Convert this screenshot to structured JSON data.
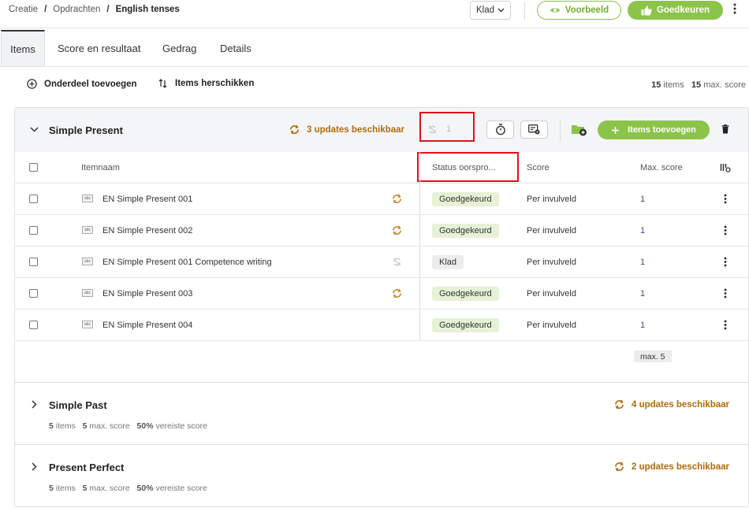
{
  "breadcrumb": {
    "items": [
      "Creatie",
      "Opdrachten",
      "English tenses"
    ],
    "separator": "/"
  },
  "header": {
    "status_select": "Klad",
    "preview_label": "Voorbeeld",
    "approve_label": "Goedkeuren"
  },
  "tabs": [
    {
      "label": "Items",
      "active": true
    },
    {
      "label": "Score en resultaat"
    },
    {
      "label": "Gedrag"
    },
    {
      "label": "Details"
    }
  ],
  "toolbar": {
    "add_part": "Onderdeel toevoegen",
    "reorder": "Items herschikken"
  },
  "summary": {
    "items_count": "15",
    "items_label": "items",
    "max_score": "15",
    "max_score_label": "max. score"
  },
  "section": {
    "title": "Simple Present",
    "updates": "3 updates beschikbaar",
    "count_field": "1",
    "add_items_label": "Items toevoegen",
    "columns": {
      "name": "Itemnaam",
      "status": "Status oorspro...",
      "score": "Score",
      "max": "Max. score"
    },
    "rows": [
      {
        "name": "EN Simple Present 001",
        "status": "Goedgekeurd",
        "score": "Per invulveld",
        "max": "1",
        "update": "available"
      },
      {
        "name": "EN Simple Present 002",
        "status": "Goedgekeurd",
        "score": "Per invulveld",
        "max": "1",
        "update": "available"
      },
      {
        "name": "EN Simple Present 001 Competence writing",
        "status": "Klad",
        "score": "Per invulveld",
        "max": "1",
        "update": "none"
      },
      {
        "name": "EN Simple Present 003",
        "status": "Goedgekeurd",
        "score": "Per invulveld",
        "max": "1",
        "update": "available"
      },
      {
        "name": "EN Simple Present 004",
        "status": "Goedgekeurd",
        "score": "Per invulveld",
        "max": "1",
        "update": ""
      }
    ],
    "total_label": "max. 5"
  },
  "collapsed_sections": [
    {
      "title": "Simple Past",
      "updates": "4 updates beschikbaar",
      "items": "5",
      "items_label": "items",
      "max": "5",
      "max_label": "max. score",
      "required": "50%",
      "required_label": "vereiste score"
    },
    {
      "title": "Present Perfect",
      "updates": "2 updates beschikbaar",
      "items": "5",
      "items_label": "items",
      "max": "5",
      "max_label": "max. score",
      "required": "50%",
      "required_label": "vereiste score"
    }
  ],
  "icon_names": [
    "chevron-down-icon",
    "eye-icon",
    "thumbs-up-icon",
    "kebab-icon",
    "plus-circle-icon",
    "reorder-icon",
    "sync-icon",
    "unlink-icon",
    "stopwatch-icon",
    "settings-card-icon",
    "folder-add-icon",
    "trash-icon",
    "columns-settings-icon",
    "chevron-right-icon",
    "document-icon"
  ],
  "colors": {
    "accent_green": "#8cc34b",
    "update_orange": "#b26b0a",
    "highlight_red": "#e0101a",
    "approved_badge": "#e6f1d6"
  }
}
